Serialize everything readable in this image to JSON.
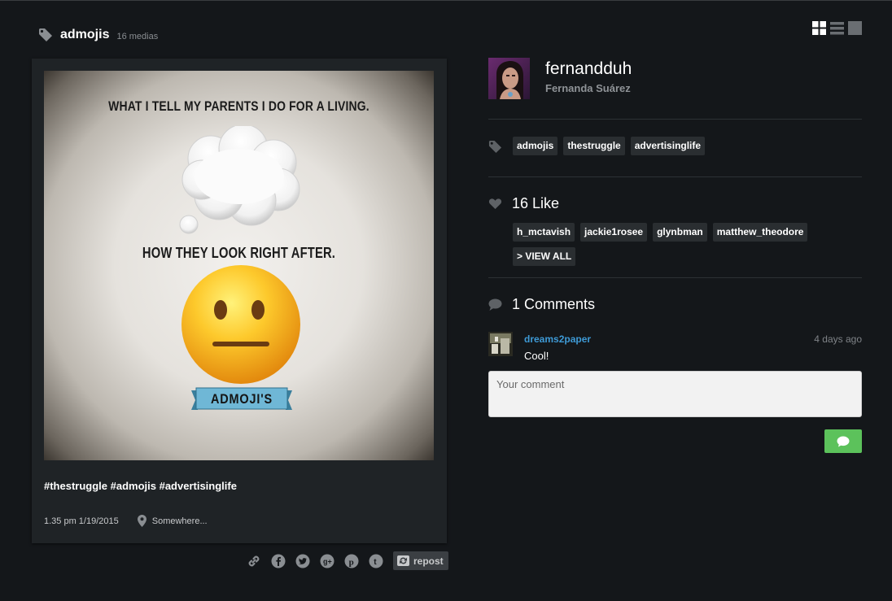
{
  "header": {
    "title": "admojis",
    "count": "16 medias"
  },
  "post": {
    "image_text": {
      "top": "WHAT I TELL MY PARENTS I DO FOR A LIVING.",
      "middle": "HOW THEY LOOK RIGHT AFTER.",
      "banner": "ADMOJI'S"
    },
    "caption": "#thestruggle #admojis #advertisinglife",
    "datetime": "1.35 pm 1/19/2015",
    "location": "Somewhere...",
    "repost_label": "repost"
  },
  "profile": {
    "username": "fernandduh",
    "fullname": "Fernanda Suárez"
  },
  "tags": [
    "admojis",
    "thestruggle",
    "advertisinglife"
  ],
  "likes": {
    "heading": "16 Like",
    "users": [
      "h_mctavish",
      "jackie1rosee",
      "glynbman",
      "matthew_theodore"
    ],
    "view_all": "> VIEW ALL"
  },
  "comments": {
    "heading": "1 Comments",
    "items": [
      {
        "user": "dreams2paper",
        "text": "Cool!",
        "time": "4 days ago"
      }
    ],
    "placeholder": "Your comment"
  },
  "colors": {
    "accent_link": "#3e9ad6",
    "send_button": "#5cc25b",
    "background": "#14171a",
    "card": "#1f2326"
  },
  "icons": [
    "tag-icon",
    "grid-view-icon",
    "list-view-icon",
    "single-view-icon",
    "location-pin-icon",
    "link-icon",
    "facebook-icon",
    "twitter-icon",
    "google-plus-icon",
    "pinterest-icon",
    "tumblr-icon",
    "repost-icon",
    "heart-icon",
    "comment-bubble-icon"
  ]
}
